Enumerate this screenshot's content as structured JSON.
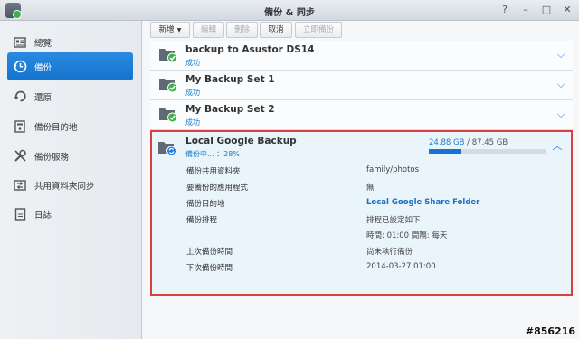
{
  "window": {
    "title": "備份 & 同步"
  },
  "window_buttons": [
    "?",
    "–",
    "□",
    "✕"
  ],
  "sidebar": {
    "items": [
      {
        "label": "總覽",
        "icon": "overview-icon"
      },
      {
        "label": "備份",
        "icon": "backup-clock-icon",
        "active": true
      },
      {
        "label": "還原",
        "icon": "restore-icon"
      },
      {
        "label": "備份目的地",
        "icon": "destination-icon"
      },
      {
        "label": "備份服務",
        "icon": "tools-icon"
      },
      {
        "label": "共用資料夾同步",
        "icon": "sync-icon"
      },
      {
        "label": "日誌",
        "icon": "log-icon"
      }
    ]
  },
  "toolbar": {
    "create_label": "新增",
    "edit_label": "編輯",
    "delete_label": "刪除",
    "cancel_label": "取消",
    "backup_now_label": "立即備份"
  },
  "tasks": [
    {
      "name": "backup to Asustor DS14",
      "status": "成功"
    },
    {
      "name": "My Backup Set 1",
      "status": "成功"
    },
    {
      "name": "My Backup Set 2",
      "status": "成功"
    }
  ],
  "expanded_task": {
    "name": "Local Google Backup",
    "status": "備份中... ：28%",
    "progress": 0.28,
    "used": "24.88 GB",
    "separator": "/",
    "total": "87.45 GB",
    "details": [
      {
        "label": "備份共用資料夾",
        "value": "family/photos"
      },
      {
        "label": "要備份的應用程式",
        "value": "無"
      },
      {
        "label": "備份目的地",
        "value": "Local Google Share Folder",
        "link": true
      },
      {
        "label": "備份排程",
        "value": "排程已設定如下"
      },
      {
        "label": "",
        "value": "時間: 01:00 間隔: 每天"
      },
      {
        "label": "上次備份時間",
        "value": "尚未執行備份"
      },
      {
        "label": "下次備份時間",
        "value": "2014-03-27 01:00"
      }
    ]
  },
  "watermark": "#856216",
  "colors": {
    "accent": "#1773cf",
    "success": "#3fb14b",
    "highlight_border": "#d84040",
    "panel_bg": "#eaf4fb"
  }
}
